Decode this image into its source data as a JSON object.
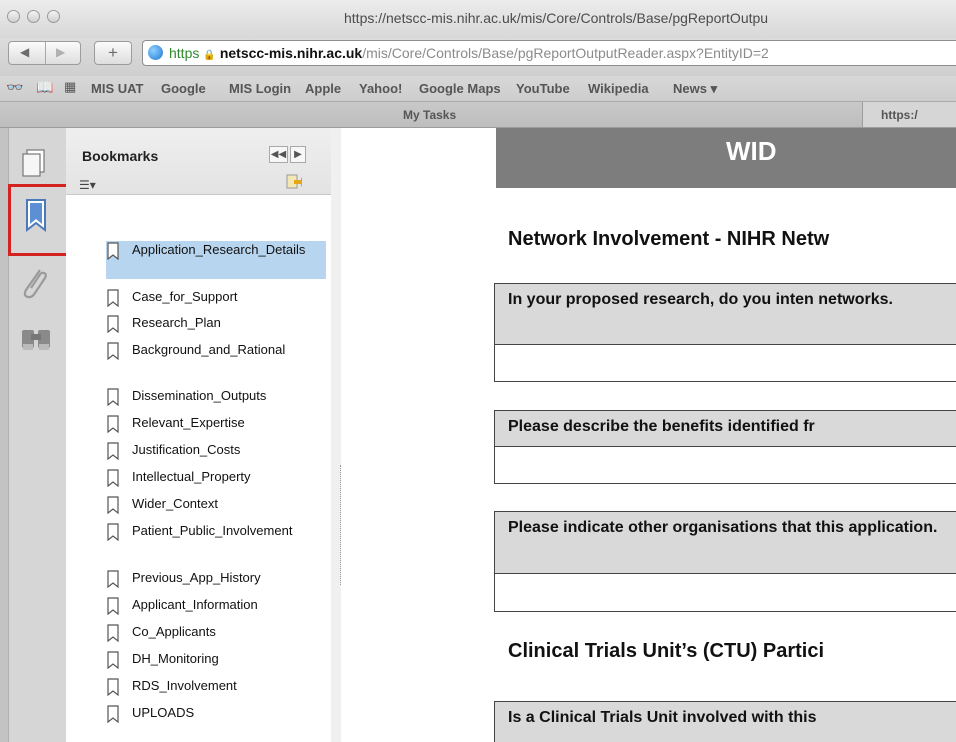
{
  "window": {
    "title_url": "https://netscc-mis.nihr.ac.uk/mis/Core/Controls/Base/pgReportOutpu"
  },
  "address_bar": {
    "scheme": "https",
    "host": "netscc-mis.nihr.ac.uk",
    "path": "/mis/Core/Controls/Base/pgReportOutputReader.aspx?EntityID=2"
  },
  "bookmarks_bar": {
    "items": [
      "MIS UAT",
      "Google",
      "MIS Login",
      "Apple",
      "Yahoo!",
      "Google Maps",
      "YouTube",
      "Wikipedia",
      "News ▾"
    ]
  },
  "tabs": {
    "active": "My Tasks",
    "right": "https:/"
  },
  "bookmarks_panel": {
    "title": "Bookmarks",
    "items": [
      {
        "label": "Application_Research_Details",
        "selected": true
      },
      {
        "label": "Case_for_Support"
      },
      {
        "label": "Research_Plan"
      },
      {
        "label": "Background_and_Rational"
      },
      {
        "label": "Dissemination_Outputs"
      },
      {
        "label": "Relevant_Expertise"
      },
      {
        "label": "Justification_Costs"
      },
      {
        "label": "Intellectual_Property"
      },
      {
        "label": "Wider_Context"
      },
      {
        "label": "Patient_Public_Involvement"
      },
      {
        "label": "Previous_App_History"
      },
      {
        "label": "Applicant_Information"
      },
      {
        "label": "Co_Applicants"
      },
      {
        "label": "DH_Monitoring"
      },
      {
        "label": "RDS_Involvement"
      },
      {
        "label": "UPLOADS"
      }
    ]
  },
  "document": {
    "band_text": "WID",
    "sections": [
      {
        "heading": "Network Involvement - NIHR Netw"
      },
      {
        "heading": "Clinical Trials Unit’s (CTU) Partici"
      }
    ],
    "questions": [
      "In your proposed research, do you inten networks.",
      "Please describe the benefits identified fr",
      "Please indicate other organisations that this application.",
      "Is a Clinical Trials Unit involved with this"
    ]
  },
  "colors": {
    "highlight": "#d32222",
    "selection": "#b7d5ee",
    "band": "#7d7d7d"
  }
}
